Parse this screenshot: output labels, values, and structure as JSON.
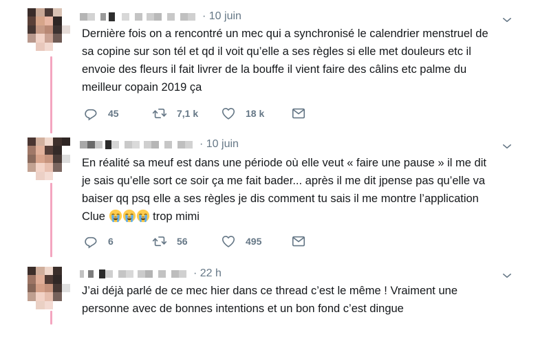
{
  "tweets": [
    {
      "time": "· 10 juin",
      "text": "Dernière fois on a rencontré un mec qui a synchronisé le calendrier menstruel de\nsa copine sur son tél et qd il voit qu’elle a ses règles si elle met douleurs etc il\nenvoie des fleurs il fait livrer de la bouffe il vient faire des câlins etc palme du\nmeilleur copain 2019 ça",
      "replies": "45",
      "retweets": "7,1 k",
      "likes": "18 k"
    },
    {
      "time": "· 10 juin",
      "text_main": "En réalité sa meuf est dans une période où elle veut « faire une pause » il me dit\nje sais qu’elle sort ce soir ça me fait bader... après il me dit jpense pas qu’elle va\nbaiser qq psq elle a ses règles je dis comment tu sais il me montre l’application\nClue ",
      "text_tail": " trop mimi",
      "emoji": [
        "loudly-crying-face",
        "loudly-crying-face",
        "loudly-crying-face"
      ],
      "replies": "6",
      "retweets": "56",
      "likes": "495"
    },
    {
      "time": "· 22 h",
      "text": "J’ai déjà parlé de ce mec hier dans ce thread c’est le même ! Vraiment une\npersonne avec de bonnes intentions et un bon fond c’est dingue"
    }
  ],
  "icons": {
    "reply": "reply-icon",
    "retweet": "retweet-icon",
    "like": "heart-icon",
    "dm": "envelope-icon",
    "menu": "chevron-down-icon"
  },
  "colors": {
    "thread_line": "#f4a6c0",
    "muted": "#657786",
    "text": "#14171a"
  }
}
